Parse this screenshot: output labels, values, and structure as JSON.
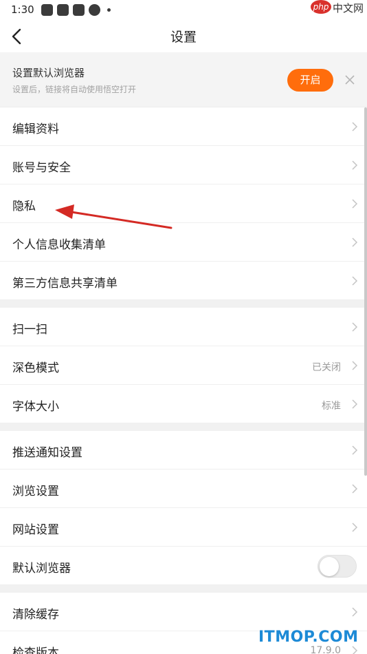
{
  "status_bar": {
    "time": "1:30"
  },
  "watermark": {
    "php": "php",
    "zh": "中文网",
    "bottom": "ITMOP.COM"
  },
  "nav": {
    "title": "设置"
  },
  "banner": {
    "title": "设置默认浏览器",
    "subtitle": "设置后，链接将自动使用悟空打开",
    "button_label": "开启"
  },
  "sections": {
    "account": [
      "编辑资料",
      "账号与安全",
      "隐私",
      "个人信息收集清单",
      "第三方信息共享清单"
    ],
    "display": [
      {
        "label": "扫一扫",
        "value": ""
      },
      {
        "label": "深色模式",
        "value": "已关闭"
      },
      {
        "label": "字体大小",
        "value": "标准"
      }
    ],
    "browse": [
      "推送通知设置",
      "浏览设置",
      "网站设置",
      "默认浏览器"
    ],
    "other": [
      {
        "label": "清除缓存",
        "value": ""
      },
      {
        "label": "检查版本",
        "value": "17.9.0"
      }
    ]
  },
  "toggle": {
    "default_browser_on": false
  },
  "colors": {
    "accent": "#ff6d0c",
    "annotation_arrow": "#d42a24"
  }
}
